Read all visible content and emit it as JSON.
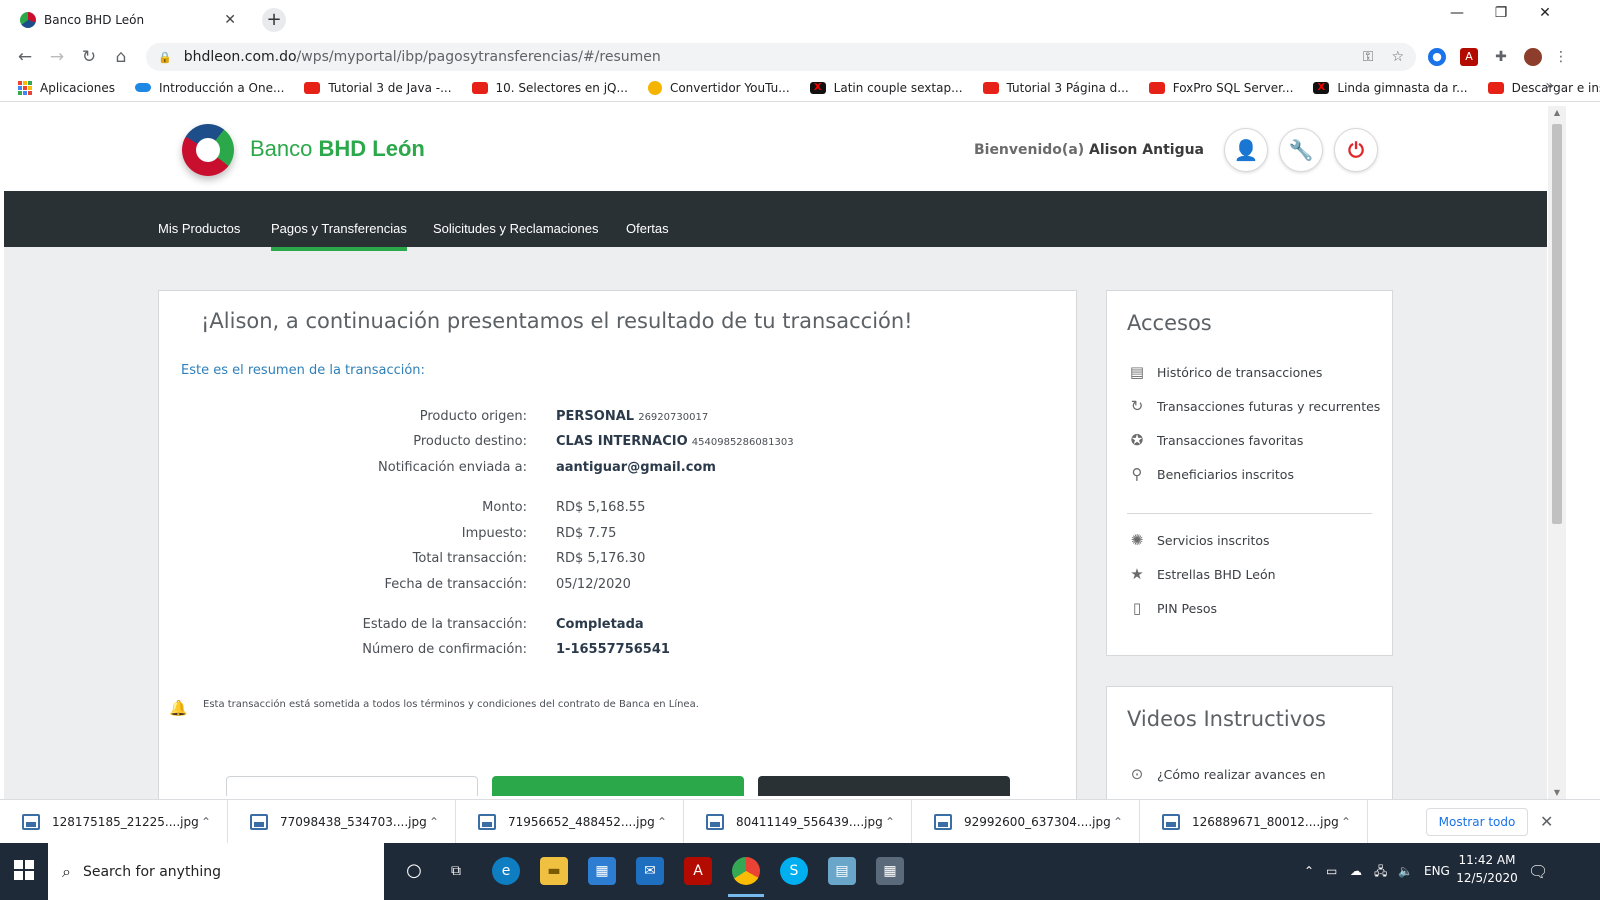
{
  "browser": {
    "tab_title": "Banco BHD León",
    "url_host": "bhdleon.com.do",
    "url_path": "/wps/myportal/ibp/pagosytransferencias/#/resumen",
    "bookmarks": [
      {
        "label": "Aplicaciones",
        "icon": "apps-grid-icon"
      },
      {
        "label": "Introducción a One...",
        "icon": "onedrive-icon"
      },
      {
        "label": "Tutorial 3 de Java -...",
        "icon": "youtube-icon"
      },
      {
        "label": "10. Selectores en jQ...",
        "icon": "youtube-icon"
      },
      {
        "label": "Convertidor YouTu...",
        "icon": "converter-icon"
      },
      {
        "label": "Latin couple sextap...",
        "icon": "x-site-icon"
      },
      {
        "label": "Tutorial 3 Página d...",
        "icon": "youtube-icon"
      },
      {
        "label": "FoxPro SQL Server...",
        "icon": "youtube-icon"
      },
      {
        "label": "Linda gimnasta da r...",
        "icon": "x-site-icon"
      },
      {
        "label": "Descargar e instalar...",
        "icon": "youtube-icon"
      }
    ]
  },
  "site": {
    "brand_prefix": "Banco ",
    "brand_name": "BHD León",
    "welcome_label": "Bienvenido(a)",
    "user_name": "Alison Antigua",
    "nav": [
      "Mis Productos",
      "Pagos y Transferencias",
      "Solicitudes y Reclamaciones",
      "Ofertas"
    ],
    "active_nav": "Pagos y Transferencias"
  },
  "result": {
    "heading": "¡Alison, a continuación presentamos el resultado de tu transacción!",
    "subheading": "Este es el resumen de la transacción:",
    "origin_label": "Producto origen:",
    "origin_name": "PERSONAL",
    "origin_number": "26920730017",
    "dest_label": "Producto destino:",
    "dest_name": "CLAS INTERNACIO",
    "dest_number": "4540985286081303",
    "notify_label": "Notificación enviada a:",
    "notify_value": "aantiguar@gmail.com",
    "amount_label": "Monto:",
    "amount_value": "RD$ 5,168.55",
    "tax_label": "Impuesto:",
    "tax_value": "RD$ 7.75",
    "total_label": "Total transacción:",
    "total_value": "RD$ 5,176.30",
    "date_label": "Fecha de transacción:",
    "date_value": "05/12/2020",
    "status_label": "Estado de la transacción:",
    "status_value": "Completada",
    "confirm_label": "Número de confirmación:",
    "confirm_value": "1-16557756541",
    "terms": "Esta transacción está sometida a todos los términos y condiciones del contrato de Banca en Línea."
  },
  "accesos": {
    "title": "Accesos",
    "items": [
      {
        "label": "Histórico de transacciones",
        "icon": "history-list-icon"
      },
      {
        "label": "Transacciones futuras y recurrentes",
        "icon": "recurring-icon"
      },
      {
        "label": "Transacciones favoritas",
        "icon": "favorite-star-icon"
      },
      {
        "label": "Beneficiarios inscritos",
        "icon": "beneficiary-icon"
      },
      {
        "label": "Servicios inscritos",
        "icon": "services-icon"
      },
      {
        "label": "Estrellas BHD León",
        "icon": "star-icon"
      },
      {
        "label": "PIN Pesos",
        "icon": "mobile-icon"
      }
    ]
  },
  "videos": {
    "title": "Videos Instructivos",
    "first_item": "¿Cómo realizar avances en"
  },
  "downloads": {
    "files": [
      "128175185_21225....jpg",
      "77098438_534703....jpg",
      "71956652_488452....jpg",
      "80411149_556439....jpg",
      "92992600_637304....jpg",
      "126889671_80012....jpg"
    ],
    "show_all": "Mostrar todo"
  },
  "taskbar": {
    "search_placeholder": "Search for anything",
    "language": "ENG",
    "time": "11:42 AM",
    "date": "12/5/2020"
  },
  "colors": {
    "brand_green": "#2ba84a",
    "nav_dark": "#2a3135",
    "link_blue": "#2f7fb8",
    "power_red": "#e0262b"
  }
}
